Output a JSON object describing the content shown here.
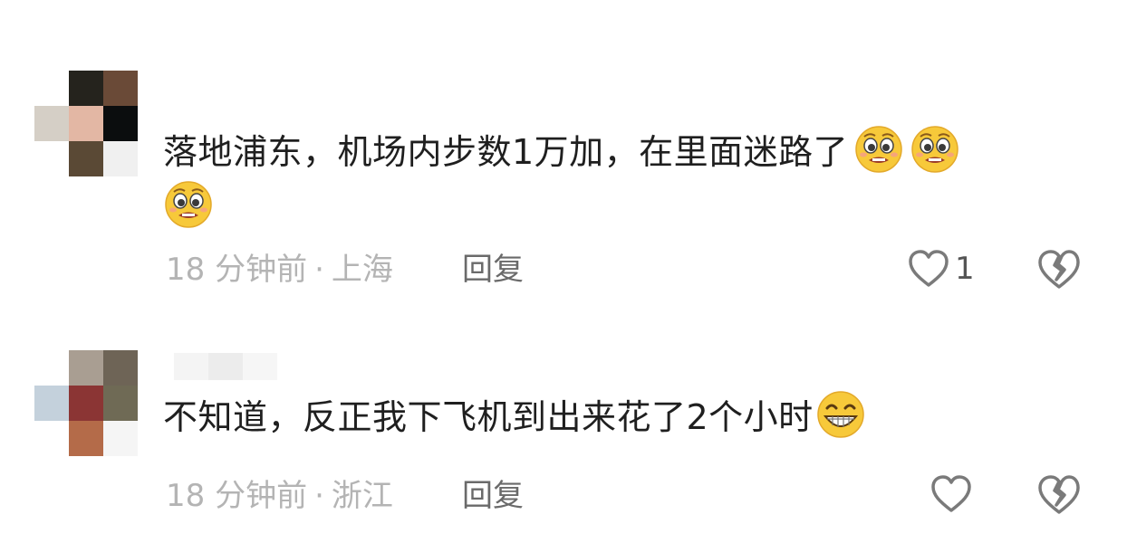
{
  "comments": [
    {
      "text": "落地浦东，机场内步数1万加，在里面迷路了",
      "emojis": [
        "pleading-face-emoji",
        "pleading-face-emoji",
        "pleading-face-emoji"
      ],
      "time": "18 分钟前",
      "separator": "·",
      "location": "上海",
      "reply_label": "回复",
      "like_count": "1",
      "avatar_colors": [
        "#ffffff",
        "#25231d",
        "#6a4a37",
        "#d5cfc6",
        "#e3b7a4",
        "#0b0d0e",
        "#ffffff",
        "#5a4935",
        "#f0f0f0"
      ]
    },
    {
      "text": "不知道，反正我下飞机到出来花了2个小时",
      "emojis": [
        "grinning-face-emoji"
      ],
      "time": "18 分钟前",
      "separator": "·",
      "location": "浙江",
      "reply_label": "回复",
      "like_count": "",
      "avatar_colors": [
        "#ffffff",
        "#a99e92",
        "#6e6456",
        "#c4d1dc",
        "#8b3534",
        "#6f6a55",
        "#ffffff",
        "#b46b49",
        "#f5f5f5"
      ]
    }
  ],
  "colors": {
    "text": "#1f1f1f",
    "meta": "#b4b4b4",
    "reply": "#6a6a6a",
    "icon": "#7a7a7a"
  }
}
